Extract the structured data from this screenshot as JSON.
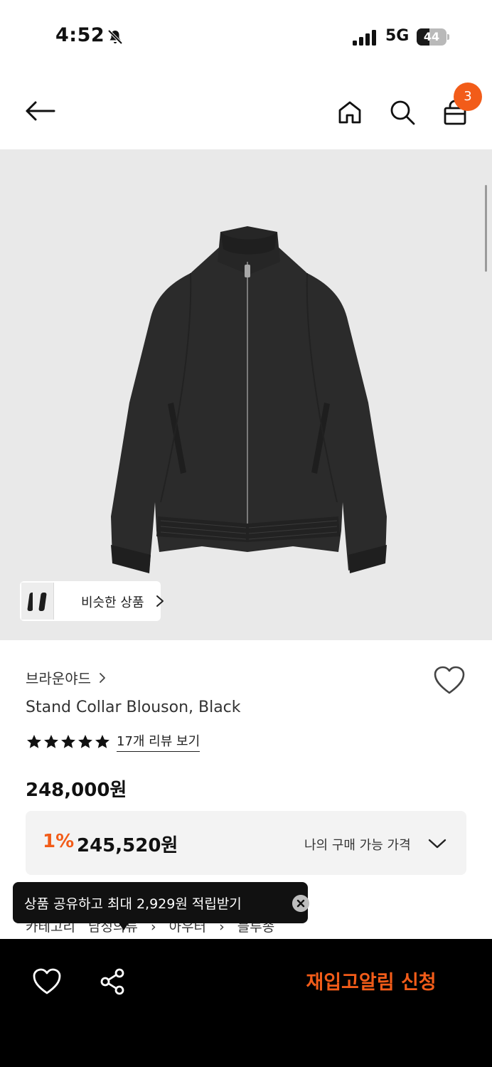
{
  "status_bar": {
    "time": "4:52",
    "network": "5G",
    "battery_level": "44",
    "icons": [
      "bell-slash-icon",
      "signal-icon",
      "battery-icon"
    ]
  },
  "nav": {
    "icons": [
      "back-arrow-icon",
      "home-icon",
      "search-icon",
      "shopping-bag-icon"
    ],
    "cart_count": "3"
  },
  "gallery": {
    "similar_products_label": "비슷한 상품"
  },
  "product": {
    "brand": "브라운야드",
    "name": "Stand Collar Blouson, Black",
    "rating_stars": 5,
    "review_link": "17개 리뷰 보기",
    "price": "248,000원",
    "member": {
      "discount": "1%",
      "final_price": "245,520원",
      "my_price_label": "나의 구매 가능 가격"
    },
    "category": [
      "카테고리",
      "남성의류",
      "아우터",
      "블루종"
    ]
  },
  "toast": {
    "text": "상품 공유하고 최대 2,929원 적립받기"
  },
  "bottom_bar": {
    "restock_button": "재입고알림 신청"
  },
  "colors": {
    "accent": "#f25c19",
    "image_bg": "#e9e9e9",
    "bottom_bar_bg": "#000000",
    "price_box_bg": "#f3f3f3"
  }
}
